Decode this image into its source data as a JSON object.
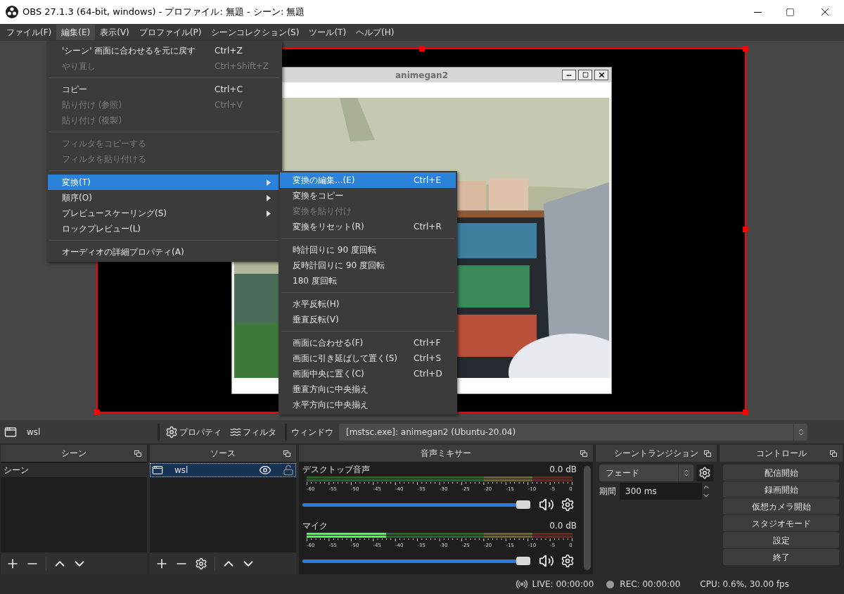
{
  "window": {
    "title": "OBS 27.1.3 (64-bit, windows) - プロファイル: 無題 - シーン: 無題"
  },
  "menu_bar": [
    {
      "label": "ファイル(F)",
      "selected": false
    },
    {
      "label": "編集(E)",
      "selected": true
    },
    {
      "label": "表示(V)",
      "selected": false
    },
    {
      "label": "プロファイル(P)",
      "selected": false
    },
    {
      "label": "シーンコレクション(S)",
      "selected": false
    },
    {
      "label": "ツール(T)",
      "selected": false
    },
    {
      "label": "ヘルプ(H)",
      "selected": false
    }
  ],
  "edit_menu": {
    "items": [
      {
        "kind": "item",
        "label": "'シーン' 画面に合わせるを元に戻す",
        "shortcut": "Ctrl+Z",
        "disabled": false,
        "submenu": false,
        "selected": false
      },
      {
        "kind": "item",
        "label": "やり直し",
        "shortcut": "Ctrl+Shift+Z",
        "disabled": true,
        "submenu": false,
        "selected": false
      },
      {
        "kind": "separator"
      },
      {
        "kind": "item",
        "label": "コピー",
        "shortcut": "Ctrl+C",
        "disabled": false,
        "submenu": false,
        "selected": false
      },
      {
        "kind": "item",
        "label": "貼り付け (参照)",
        "shortcut": "Ctrl+V",
        "disabled": true,
        "submenu": false,
        "selected": false
      },
      {
        "kind": "item",
        "label": "貼り付け (複製)",
        "disabled": true,
        "submenu": false,
        "selected": false
      },
      {
        "kind": "separator"
      },
      {
        "kind": "item",
        "label": "フィルタをコピーする",
        "disabled": true,
        "submenu": false,
        "selected": false
      },
      {
        "kind": "item",
        "label": "フィルタを貼り付ける",
        "disabled": true,
        "submenu": false,
        "selected": false
      },
      {
        "kind": "separator"
      },
      {
        "kind": "item",
        "label": "変換(T)",
        "disabled": false,
        "submenu": true,
        "selected": true
      },
      {
        "kind": "item",
        "label": "順序(O)",
        "disabled": false,
        "submenu": true,
        "selected": false
      },
      {
        "kind": "item",
        "label": "プレビュースケーリング(S)",
        "disabled": false,
        "submenu": true,
        "selected": false
      },
      {
        "kind": "item",
        "label": "ロックプレビュー(L)",
        "disabled": false,
        "submenu": false,
        "selected": false
      },
      {
        "kind": "separator"
      },
      {
        "kind": "item",
        "label": "オーディオの詳細プロパティ(A)",
        "disabled": false,
        "submenu": false,
        "selected": false
      }
    ]
  },
  "transform_submenu": {
    "items": [
      {
        "kind": "item",
        "label": "変換の編集...(E)",
        "shortcut": "Ctrl+E",
        "disabled": false,
        "selected": true
      },
      {
        "kind": "item",
        "label": "変換をコピー",
        "disabled": false,
        "selected": false
      },
      {
        "kind": "item",
        "label": "変換を貼り付け",
        "disabled": true,
        "selected": false
      },
      {
        "kind": "item",
        "label": "変換をリセット(R)",
        "shortcut": "Ctrl+R",
        "disabled": false,
        "selected": false
      },
      {
        "kind": "separator"
      },
      {
        "kind": "item",
        "label": "時計回りに 90 度回転",
        "disabled": false,
        "selected": false
      },
      {
        "kind": "item",
        "label": "反時計回りに 90 度回転",
        "disabled": false,
        "selected": false
      },
      {
        "kind": "item",
        "label": "180 度回転",
        "disabled": false,
        "selected": false
      },
      {
        "kind": "separator"
      },
      {
        "kind": "item",
        "label": "水平反転(H)",
        "disabled": false,
        "selected": false
      },
      {
        "kind": "item",
        "label": "垂直反転(V)",
        "disabled": false,
        "selected": false
      },
      {
        "kind": "separator"
      },
      {
        "kind": "item",
        "label": "画面に合わせる(F)",
        "shortcut": "Ctrl+F",
        "disabled": false,
        "selected": false
      },
      {
        "kind": "item",
        "label": "画面に引き延ばして置く(S)",
        "shortcut": "Ctrl+S",
        "disabled": false,
        "selected": false
      },
      {
        "kind": "item",
        "label": "画面中央に置く(C)",
        "shortcut": "Ctrl+D",
        "disabled": false,
        "selected": false
      },
      {
        "kind": "item",
        "label": "垂直方向に中央揃え",
        "disabled": false,
        "selected": false
      },
      {
        "kind": "item",
        "label": "水平方向に中央揃え",
        "disabled": false,
        "selected": false
      }
    ]
  },
  "preview": {
    "source_window": {
      "title": "animegan2"
    }
  },
  "source_toolbar": {
    "source_name": "wsl",
    "buttons": [
      "プロパティ",
      "フィルタ"
    ],
    "window_label": "ウィンドウ",
    "window_value": "[mstsc.exe]: animegan2 (Ubuntu-20.04)"
  },
  "scenes": {
    "title": "シーン",
    "items": [
      {
        "label": "シーン",
        "selected": true
      }
    ]
  },
  "sources": {
    "title": "ソース",
    "items": [
      {
        "label": "wsl",
        "selected": true,
        "visible": true,
        "locked": false
      }
    ]
  },
  "mixer": {
    "title": "音声ミキサー",
    "channels": [
      {
        "name": "デスクトップ音声",
        "reading": "0.0 dB",
        "level": 0,
        "ticks": [
          "-60",
          "-55",
          "-50",
          "-45",
          "-40",
          "-35",
          "-30",
          "-25",
          "-20",
          "-15",
          "-10",
          "-5",
          "0"
        ],
        "volume": {
          "level": 0.94
        }
      },
      {
        "name": "マイク",
        "reading": "0.0 dB",
        "level": 0.3,
        "ticks": [
          "-60",
          "-55",
          "-50",
          "-45",
          "-40",
          "-35",
          "-30",
          "-25",
          "-20",
          "-15",
          "-10",
          "-5",
          "0"
        ],
        "volume": {
          "level": 0.94
        }
      }
    ]
  },
  "transitions": {
    "title": "シーントランジション",
    "transition": "フェード",
    "duration_label": "期間",
    "duration": "300 ms"
  },
  "controls": {
    "title": "コントロール",
    "buttons": [
      "配信開始",
      "録画開始",
      "仮想カメラ開始",
      "スタジオモード",
      "設定",
      "終了"
    ]
  },
  "status_bar": {
    "live": "LIVE: 00:00:00",
    "rec": "REC: 00:00:00",
    "cpu": "CPU: 0.6%, 30.00 fps"
  }
}
